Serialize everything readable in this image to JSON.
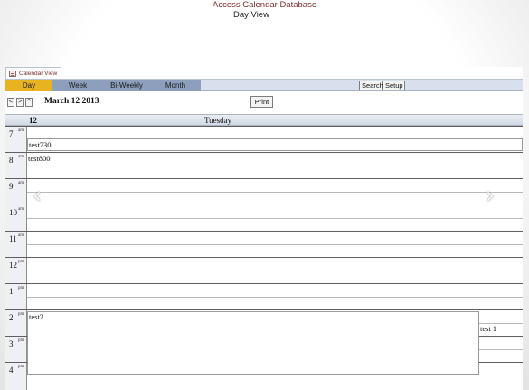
{
  "app": {
    "title": "Access Calendar Database",
    "subtitle": "Day View"
  },
  "document_tab": {
    "label": "Calendar View",
    "icon": "form-icon"
  },
  "view_tabs": {
    "day": "Day",
    "week": "Week",
    "biweekly": "Bi-Weekly",
    "month": "Month",
    "active": "Day"
  },
  "toolbar": {
    "search_label": "Search",
    "setup_label": "Setup",
    "print_label": "Print",
    "prev_label": "<",
    "next_label": ">",
    "up_label": "^"
  },
  "date": {
    "label": "March 12 2013",
    "day_number": "12",
    "day_name": "Tuesday"
  },
  "hours": [
    {
      "hour": "7",
      "ampm": "am"
    },
    {
      "hour": "8",
      "ampm": "am"
    },
    {
      "hour": "9",
      "ampm": "am"
    },
    {
      "hour": "10",
      "ampm": "am"
    },
    {
      "hour": "11",
      "ampm": "am"
    },
    {
      "hour": "12",
      "ampm": "pm"
    },
    {
      "hour": "1",
      "ampm": "pm"
    },
    {
      "hour": "2",
      "ampm": "pm"
    },
    {
      "hour": "3",
      "ampm": "pm"
    },
    {
      "hour": "4",
      "ampm": "pm"
    }
  ],
  "events": {
    "e730": "test730",
    "e800": "test800",
    "e2": "test2",
    "e1": "test 1"
  },
  "colors": {
    "active_tab": "#e7b321",
    "inactive_tab": "#8d9fbc",
    "title_accent": "#7a2b2b"
  },
  "carousel": {
    "prev_icon": "chevron-left-icon",
    "next_icon": "chevron-right-icon",
    "prev_glyph": "‹",
    "next_glyph": "›"
  }
}
